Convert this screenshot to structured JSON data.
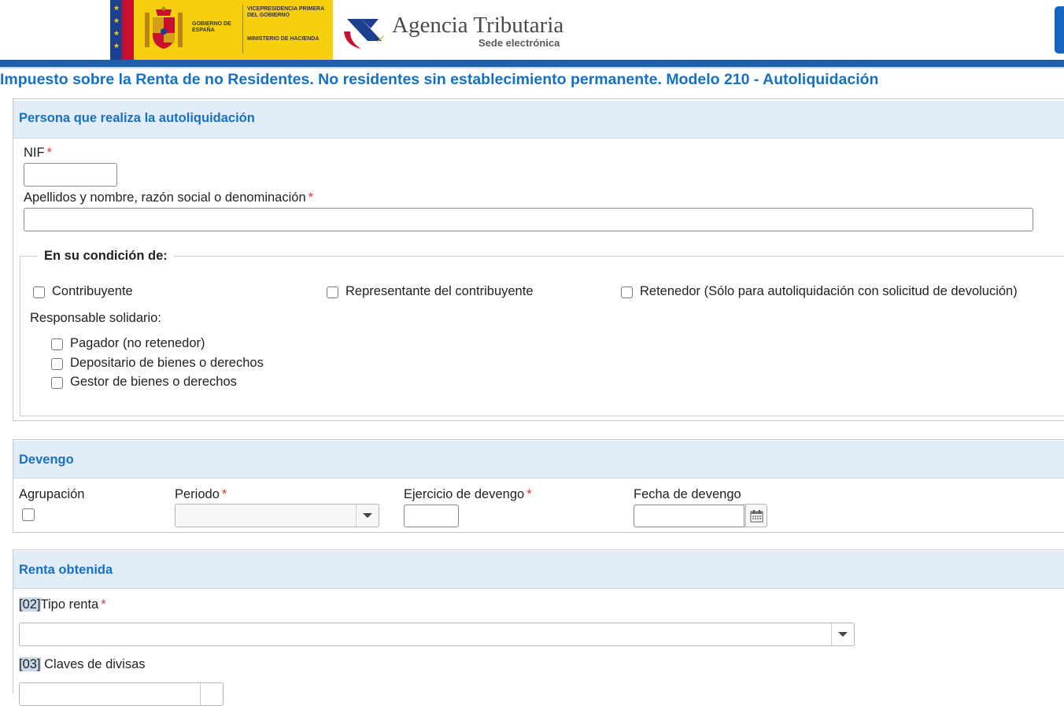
{
  "header": {
    "gov_name": "GOBIERNO DE ESPAÑA",
    "vice_name": "VICEPRESIDENCIA PRIMERA DEL GOBIERNO",
    "ministry_name": "MINISTERIO DE HACIENDA",
    "agency_name": "Agencia Tributaria",
    "agency_sub": "Sede electrónica"
  },
  "page_title": "Impuesto sobre la Renta de no Residentes. No residentes sin establecimiento permanente. Modelo 210 - Autoliquidación",
  "persona": {
    "title": "Persona que realiza la autoliquidación",
    "nif_label": "NIF",
    "nif_value": "",
    "nombre_label": "Apellidos y nombre, razón social o denominación",
    "nombre_value": "",
    "required_mark": "*",
    "condicion": {
      "legend": "En su condición de:",
      "contribuyente": "Contribuyente",
      "representante": "Representante del contribuyente",
      "retenedor": "Retenedor (Sólo para autoliquidación con solicitud de devolución)",
      "responsable_label": "Responsable solidario:",
      "pagador": "Pagador (no retenedor)",
      "depositario": "Depositario de bienes o derechos",
      "gestor": "Gestor de bienes o derechos"
    }
  },
  "devengo": {
    "title": "Devengo",
    "agrupacion_label": "Agrupación",
    "periodo_label": "Periodo",
    "periodo_value": "",
    "ejercicio_label": "Ejercicio de devengo",
    "ejercicio_value": "",
    "fecha_label": "Fecha de devengo",
    "fecha_value": ""
  },
  "renta": {
    "title": "Renta obtenida",
    "tipo_code": "[02]",
    "tipo_label": "Tipo renta",
    "tipo_value": "",
    "divisas_code": "[03]",
    "divisas_label": " Claves de divisas"
  }
}
